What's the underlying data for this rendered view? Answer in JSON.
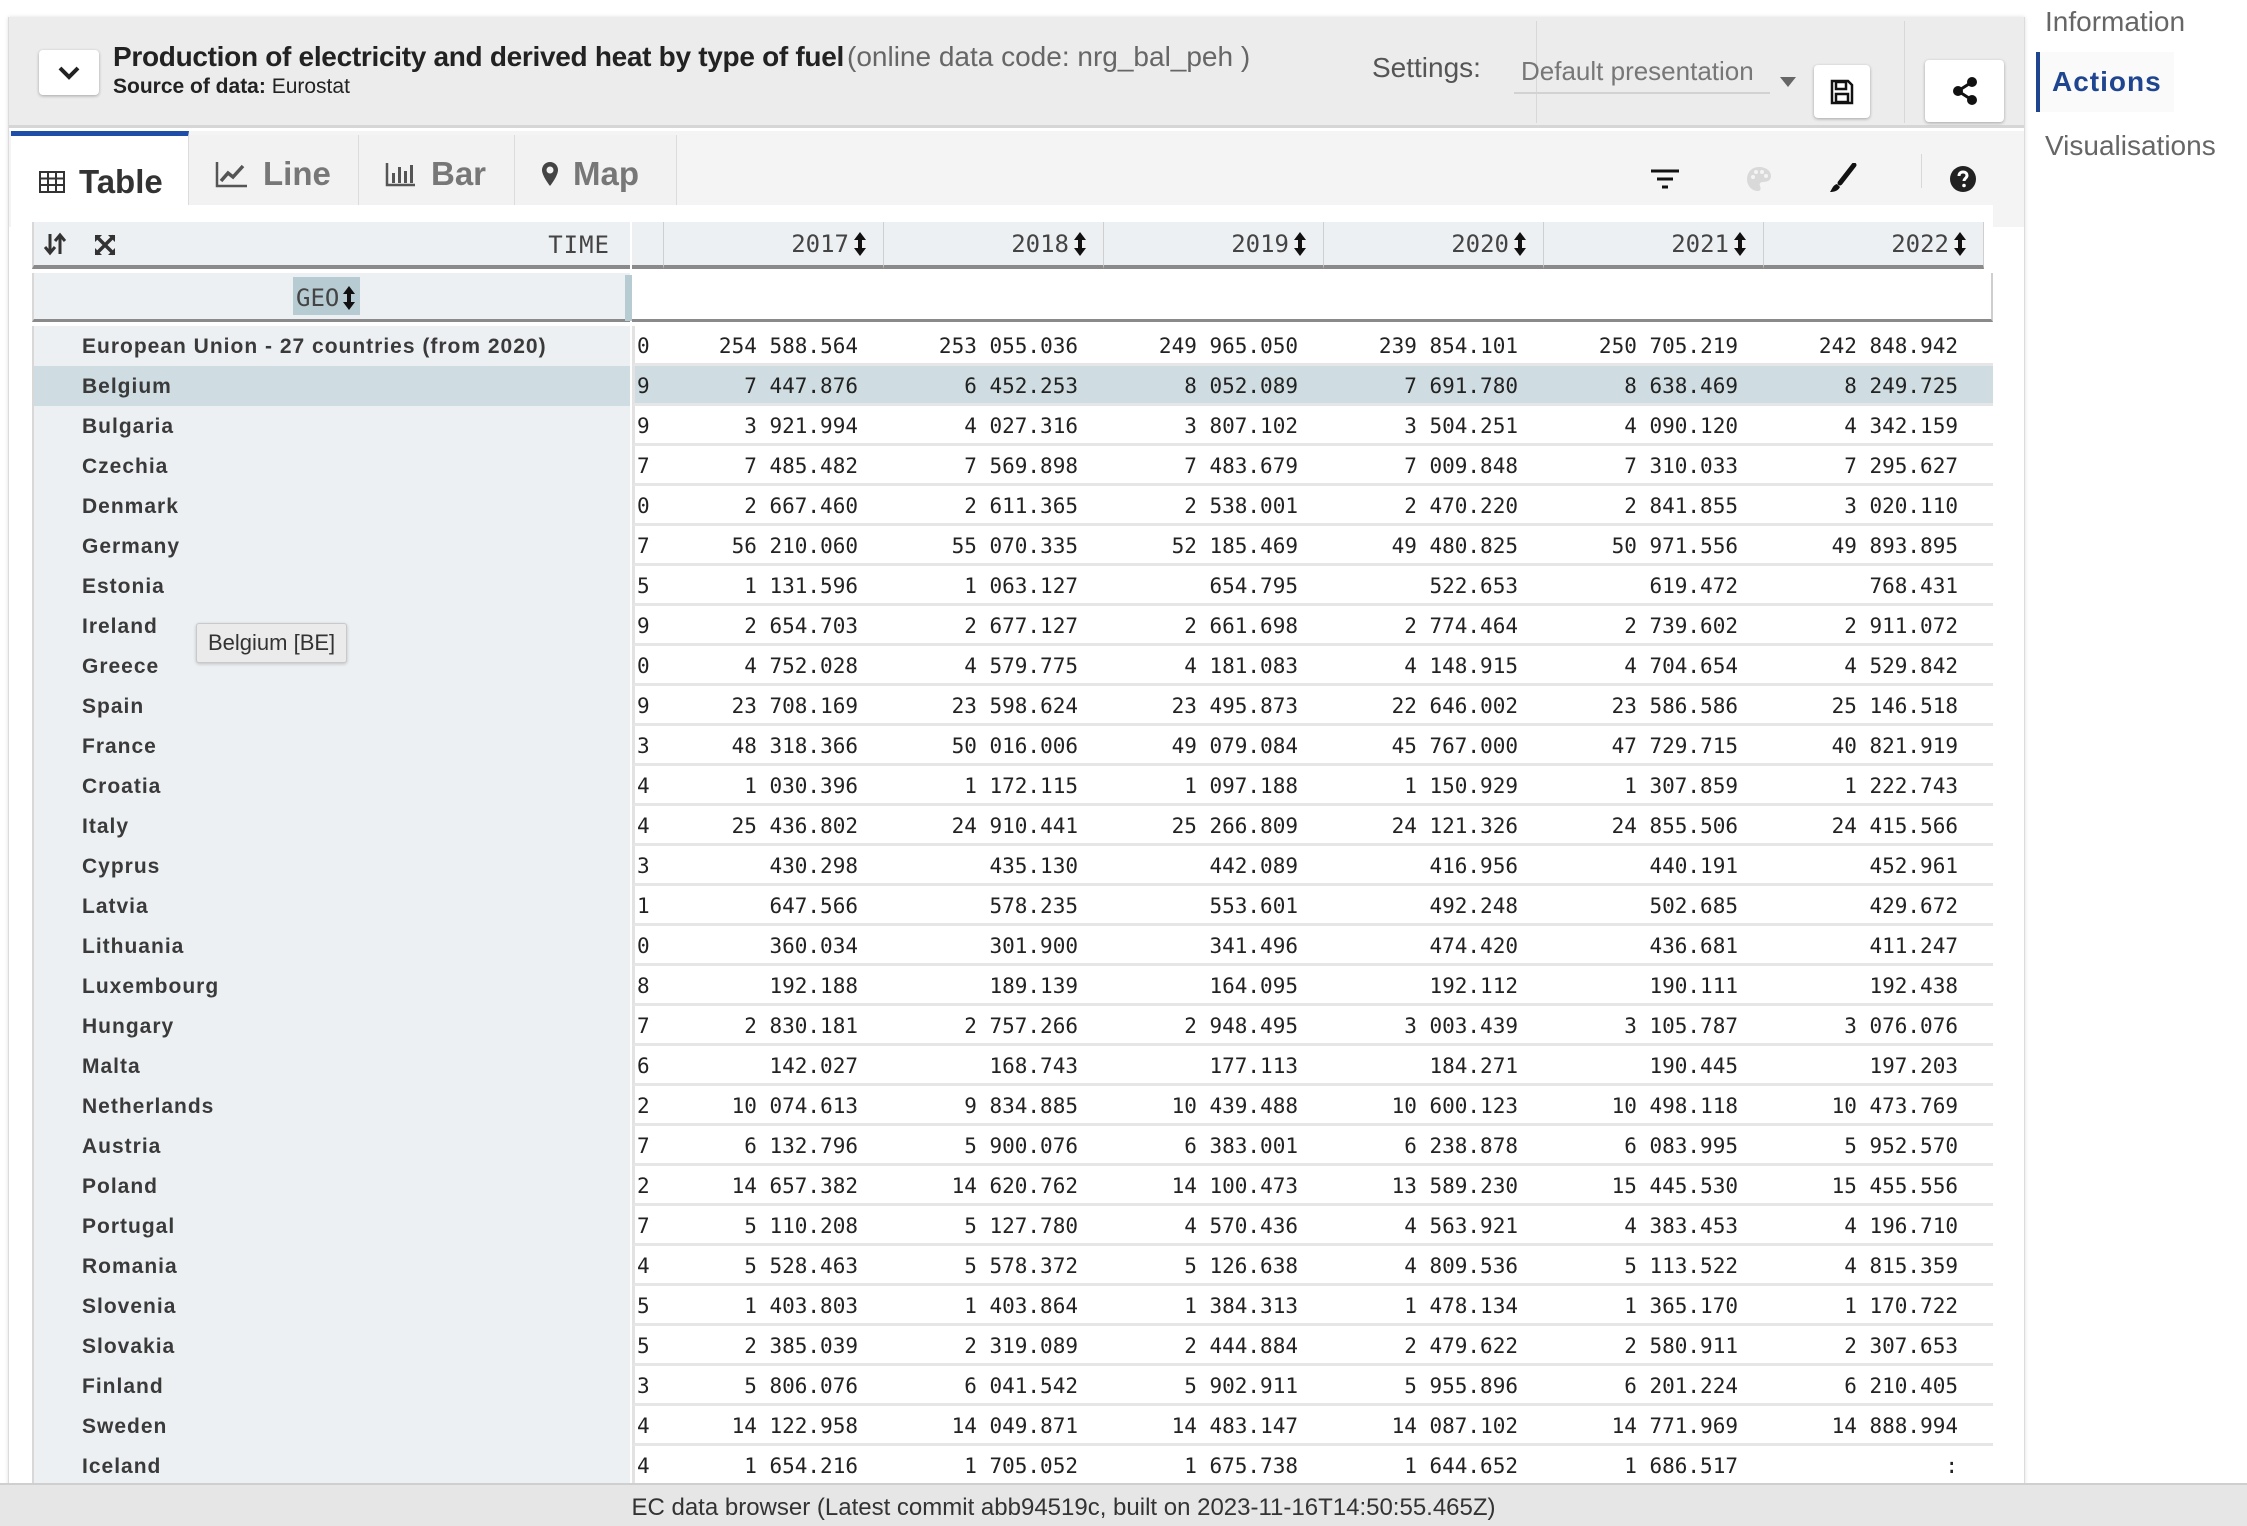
{
  "header": {
    "title": "Production of electricity and derived heat by type of fuel",
    "online_code": "(online data code: nrg_bal_peh )",
    "source_label": "Source of data:",
    "source_value": "Eurostat",
    "settings_label": "Settings:",
    "settings_value": "Default presentation",
    "icons": {
      "collapse": "chevron-down-icon",
      "save": "save-icon",
      "share": "share-icon"
    }
  },
  "tabs": [
    {
      "label": "Table",
      "icon": "table-icon",
      "active": true
    },
    {
      "label": "Line",
      "icon": "line-chart-icon",
      "active": false
    },
    {
      "label": "Bar",
      "icon": "bar-chart-icon",
      "active": false
    },
    {
      "label": "Map",
      "icon": "map-marker-icon",
      "active": false
    }
  ],
  "toolbar": {
    "icons": [
      "filter-icon",
      "palette-icon",
      "brush-icon",
      "help-icon"
    ]
  },
  "right_nav": {
    "items": [
      {
        "label": "Information",
        "active": false
      },
      {
        "label": "Actions",
        "active": true
      },
      {
        "label": "Visualisations",
        "active": false
      }
    ]
  },
  "table": {
    "time_label": "TIME",
    "geo_label": "GEO",
    "columns": [
      "2017",
      "2018",
      "2019",
      "2020",
      "2021",
      "2022"
    ],
    "tooltip": "Belgium [BE]",
    "highlighted_row": "Belgium",
    "rows": [
      {
        "geo": "European Union - 27 countries (from 2020)",
        "partial": "0",
        "values": [
          "254 588.564",
          "253 055.036",
          "249 965.050",
          "239 854.101",
          "250 705.219",
          "242 848.942"
        ]
      },
      {
        "geo": "Belgium",
        "partial": "9",
        "values": [
          "7 447.876",
          "6 452.253",
          "8 052.089",
          "7 691.780",
          "8 638.469",
          "8 249.725"
        ]
      },
      {
        "geo": "Bulgaria",
        "partial": "9",
        "values": [
          "3 921.994",
          "4 027.316",
          "3 807.102",
          "3 504.251",
          "4 090.120",
          "4 342.159"
        ]
      },
      {
        "geo": "Czechia",
        "partial": "7",
        "values": [
          "7 485.482",
          "7 569.898",
          "7 483.679",
          "7 009.848",
          "7 310.033",
          "7 295.627"
        ]
      },
      {
        "geo": "Denmark",
        "partial": "0",
        "values": [
          "2 667.460",
          "2 611.365",
          "2 538.001",
          "2 470.220",
          "2 841.855",
          "3 020.110"
        ]
      },
      {
        "geo": "Germany",
        "partial": "7",
        "values": [
          "56 210.060",
          "55 070.335",
          "52 185.469",
          "49 480.825",
          "50 971.556",
          "49 893.895"
        ]
      },
      {
        "geo": "Estonia",
        "partial": "5",
        "values": [
          "1 131.596",
          "1 063.127",
          "654.795",
          "522.653",
          "619.472",
          "768.431"
        ]
      },
      {
        "geo": "Ireland",
        "partial": "9",
        "values": [
          "2 654.703",
          "2 677.127",
          "2 661.698",
          "2 774.464",
          "2 739.602",
          "2 911.072"
        ]
      },
      {
        "geo": "Greece",
        "partial": "0",
        "values": [
          "4 752.028",
          "4 579.775",
          "4 181.083",
          "4 148.915",
          "4 704.654",
          "4 529.842"
        ]
      },
      {
        "geo": "Spain",
        "partial": "9",
        "values": [
          "23 708.169",
          "23 598.624",
          "23 495.873",
          "22 646.002",
          "23 586.586",
          "25 146.518"
        ]
      },
      {
        "geo": "France",
        "partial": "3",
        "values": [
          "48 318.366",
          "50 016.006",
          "49 079.084",
          "45 767.000",
          "47 729.715",
          "40 821.919"
        ]
      },
      {
        "geo": "Croatia",
        "partial": "4",
        "values": [
          "1 030.396",
          "1 172.115",
          "1 097.188",
          "1 150.929",
          "1 307.859",
          "1 222.743"
        ]
      },
      {
        "geo": "Italy",
        "partial": "4",
        "values": [
          "25 436.802",
          "24 910.441",
          "25 266.809",
          "24 121.326",
          "24 855.506",
          "24 415.566"
        ]
      },
      {
        "geo": "Cyprus",
        "partial": "3",
        "values": [
          "430.298",
          "435.130",
          "442.089",
          "416.956",
          "440.191",
          "452.961"
        ]
      },
      {
        "geo": "Latvia",
        "partial": "1",
        "values": [
          "647.566",
          "578.235",
          "553.601",
          "492.248",
          "502.685",
          "429.672"
        ]
      },
      {
        "geo": "Lithuania",
        "partial": "0",
        "values": [
          "360.034",
          "301.900",
          "341.496",
          "474.420",
          "436.681",
          "411.247"
        ]
      },
      {
        "geo": "Luxembourg",
        "partial": "8",
        "values": [
          "192.188",
          "189.139",
          "164.095",
          "192.112",
          "190.111",
          "192.438"
        ]
      },
      {
        "geo": "Hungary",
        "partial": "7",
        "values": [
          "2 830.181",
          "2 757.266",
          "2 948.495",
          "3 003.439",
          "3 105.787",
          "3 076.076"
        ]
      },
      {
        "geo": "Malta",
        "partial": "6",
        "values": [
          "142.027",
          "168.743",
          "177.113",
          "184.271",
          "190.445",
          "197.203"
        ]
      },
      {
        "geo": "Netherlands",
        "partial": "2",
        "values": [
          "10 074.613",
          "9 834.885",
          "10 439.488",
          "10 600.123",
          "10 498.118",
          "10 473.769"
        ]
      },
      {
        "geo": "Austria",
        "partial": "7",
        "values": [
          "6 132.796",
          "5 900.076",
          "6 383.001",
          "6 238.878",
          "6 083.995",
          "5 952.570"
        ]
      },
      {
        "geo": "Poland",
        "partial": "2",
        "values": [
          "14 657.382",
          "14 620.762",
          "14 100.473",
          "13 589.230",
          "15 445.530",
          "15 455.556"
        ]
      },
      {
        "geo": "Portugal",
        "partial": "7",
        "values": [
          "5 110.208",
          "5 127.780",
          "4 570.436",
          "4 563.921",
          "4 383.453",
          "4 196.710"
        ]
      },
      {
        "geo": "Romania",
        "partial": "4",
        "values": [
          "5 528.463",
          "5 578.372",
          "5 126.638",
          "4 809.536",
          "5 113.522",
          "4 815.359"
        ]
      },
      {
        "geo": "Slovenia",
        "partial": "5",
        "values": [
          "1 403.803",
          "1 403.864",
          "1 384.313",
          "1 478.134",
          "1 365.170",
          "1 170.722"
        ]
      },
      {
        "geo": "Slovakia",
        "partial": "5",
        "values": [
          "2 385.039",
          "2 319.089",
          "2 444.884",
          "2 479.622",
          "2 580.911",
          "2 307.653"
        ]
      },
      {
        "geo": "Finland",
        "partial": "3",
        "values": [
          "5 806.076",
          "6 041.542",
          "5 902.911",
          "5 955.896",
          "6 201.224",
          "6 210.405"
        ]
      },
      {
        "geo": "Sweden",
        "partial": "4",
        "values": [
          "14 122.958",
          "14 049.871",
          "14 483.147",
          "14 087.102",
          "14 771.969",
          "14 888.994"
        ]
      },
      {
        "geo": "Iceland",
        "partial": "4",
        "values": [
          "1 654.216",
          "1 705.052",
          "1 675.738",
          "1 644.652",
          "1 686.517",
          ":"
        ]
      }
    ]
  },
  "footer": {
    "text": "EC data browser (Latest commit abb94519c, built on 2023-11-16T14:50:55.465Z)"
  },
  "colors": {
    "accent": "#1f4ea8",
    "nav_active": "#1f4590",
    "row_highlight": "#cfdde2",
    "geo_header_highlight": "#b7cbd2"
  }
}
